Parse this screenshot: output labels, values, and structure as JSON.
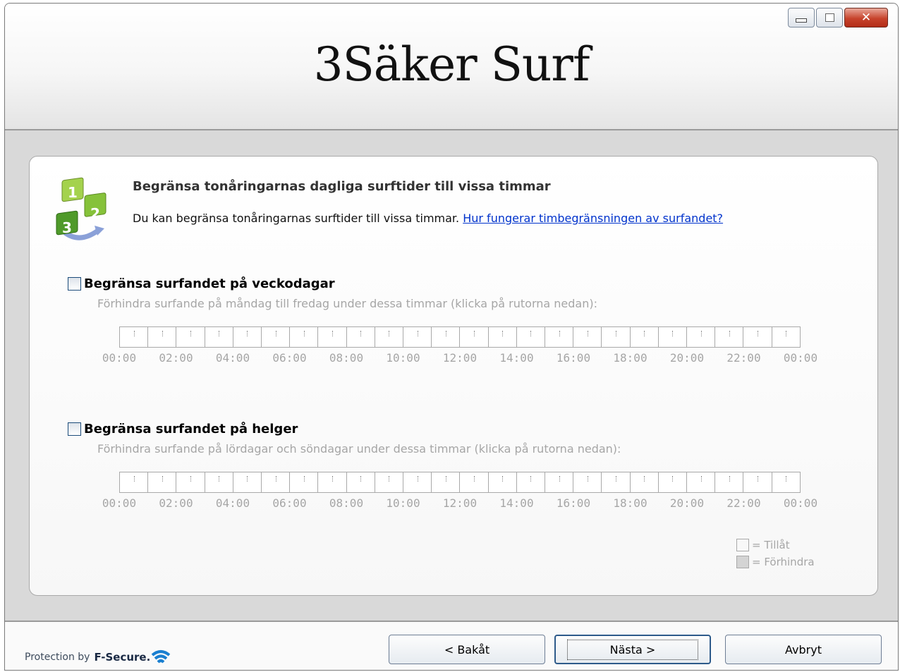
{
  "window": {
    "title": "3Säker Surf"
  },
  "page": {
    "heading": "Begränsa tonåringarnas dagliga surftider till vissa timmar",
    "description": "Du kan begränsa tonåringarnas surftider till vissa timmar.",
    "help_link": "Hur fungerar timbegränsningen av surfandet?",
    "steps_icon_digits": [
      "1",
      "2",
      "3"
    ]
  },
  "weekdays": {
    "label": "Begränsa surfandet på veckodagar",
    "description": "Förhindra surfande på måndag till fredag under dessa timmar (klicka på rutorna nedan):",
    "checked": false
  },
  "weekends": {
    "label": "Begränsa surfandet på helger",
    "description": "Förhindra surfande på lördagar och söndagar under dessa timmar (klicka på rutorna nedan):",
    "checked": false
  },
  "time_ticks": [
    "00:00",
    "02:00",
    "04:00",
    "06:00",
    "08:00",
    "10:00",
    "12:00",
    "14:00",
    "16:00",
    "18:00",
    "20:00",
    "22:00",
    "00:00"
  ],
  "legend": {
    "allow": "= Tillåt",
    "block": "= Förhindra"
  },
  "footer": {
    "protection_text": "Protection by",
    "brand": "F-Secure.",
    "back_button": "< Bakåt",
    "next_button": "Nästa >",
    "cancel_button": "Avbryt"
  },
  "colors": {
    "link": "#0033cc",
    "disabled_text": "#a6a6a6",
    "close_button": "#c7432c"
  }
}
